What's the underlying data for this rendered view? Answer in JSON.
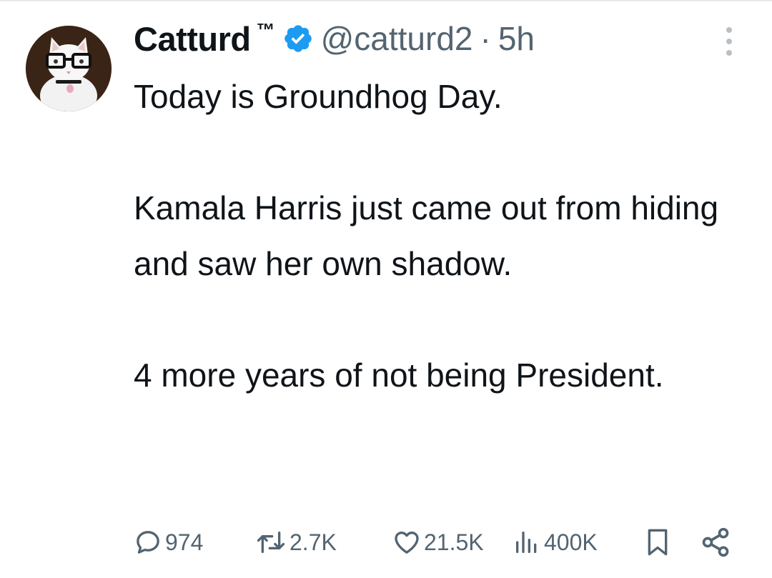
{
  "author": {
    "display_name": "Catturd",
    "trademark": "™",
    "handle": "@catturd2",
    "separator": "·",
    "time": "5h"
  },
  "tweet": {
    "paragraphs": [
      "Today is Groundhog Day.",
      "Kamala Harris just came out from hiding and saw her own shadow.",
      "4 more years of not being President."
    ]
  },
  "metrics": {
    "replies": "974",
    "reposts": "2.7K",
    "likes": "21.5K",
    "views": "400K"
  },
  "colors": {
    "text": "#0f1419",
    "secondary": "#536471",
    "verified": "#1d9bf0"
  },
  "icons": [
    "more-icon",
    "verified-icon",
    "reply-icon",
    "repost-icon",
    "like-icon",
    "views-icon",
    "bookmark-icon",
    "share-icon"
  ]
}
